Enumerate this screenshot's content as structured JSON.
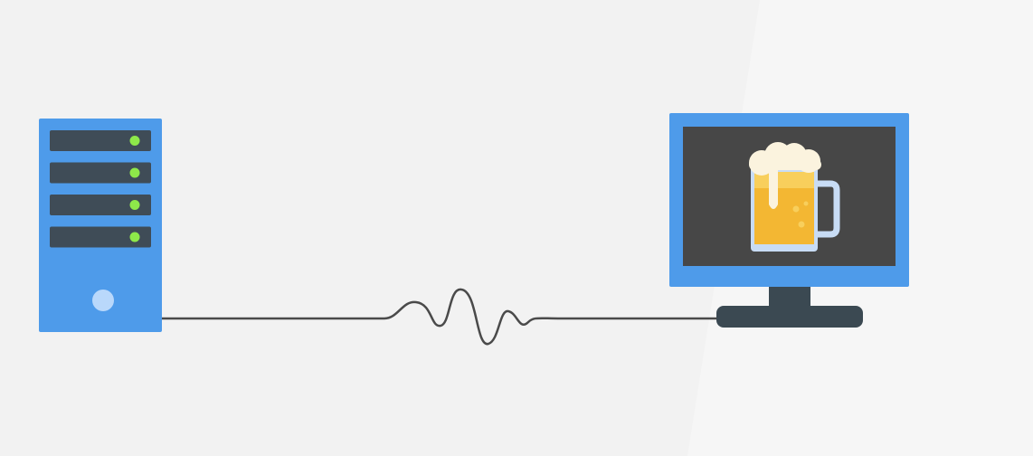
{
  "diagram": {
    "colors": {
      "background": "#f2f2f2",
      "device_blue": "#4e9bea",
      "slot_dark": "#3f4c57",
      "led_green": "#8ee84a",
      "power_button": "#b9d8fb",
      "screen_dark": "#474747",
      "stand_dark": "#3b4952",
      "cable": "#4a4a4a",
      "beer_body": "#f3b733",
      "beer_light": "#f8cf5c",
      "foam": "#fbf3de",
      "glass_handle": "#c8dcf5"
    },
    "nodes": [
      {
        "id": "server",
        "icon": "server-tower-icon",
        "led_count": 4
      },
      {
        "id": "monitor",
        "icon": "monitor-icon",
        "screen_icon": "beer-mug-icon"
      }
    ],
    "edges": [
      {
        "from": "server",
        "to": "monitor",
        "style": "wavy-signal-cable"
      }
    ]
  }
}
